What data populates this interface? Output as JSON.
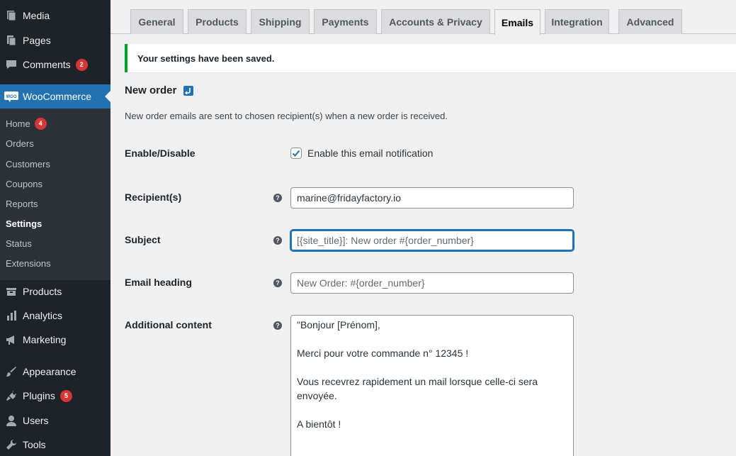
{
  "sidebar": {
    "items": [
      {
        "label": "Media",
        "icon": "media-icon"
      },
      {
        "label": "Pages",
        "icon": "pages-icon"
      },
      {
        "label": "Comments",
        "icon": "comments-icon",
        "badge": "2"
      },
      {
        "label": "WooCommerce",
        "icon": "woocommerce-icon"
      },
      {
        "label": "Products",
        "icon": "products-icon"
      },
      {
        "label": "Analytics",
        "icon": "analytics-icon"
      },
      {
        "label": "Marketing",
        "icon": "marketing-icon"
      },
      {
        "label": "Appearance",
        "icon": "appearance-icon"
      },
      {
        "label": "Plugins",
        "icon": "plugins-icon",
        "badge": "5"
      },
      {
        "label": "Users",
        "icon": "users-icon"
      },
      {
        "label": "Tools",
        "icon": "tools-icon"
      }
    ],
    "woo_icon_text": "WOO",
    "submenu": [
      {
        "label": "Home",
        "badge": "4"
      },
      {
        "label": "Orders"
      },
      {
        "label": "Customers"
      },
      {
        "label": "Coupons"
      },
      {
        "label": "Reports"
      },
      {
        "label": "Settings"
      },
      {
        "label": "Status"
      },
      {
        "label": "Extensions"
      }
    ]
  },
  "tabs": [
    "General",
    "Products",
    "Shipping",
    "Payments",
    "Accounts & Privacy",
    "Emails",
    "Integration",
    "Advanced"
  ],
  "active_tab": "Emails",
  "notice": "Your settings have been saved.",
  "page": {
    "title": "New order",
    "description": "New order emails are sent to chosen recipient(s) when a new order is received."
  },
  "form": {
    "enable_label": "Enable/Disable",
    "enable_checkbox_label": "Enable this email notification",
    "enable_checked": true,
    "recipient_label": "Recipient(s)",
    "recipient_value": "marine@fridayfactory.io",
    "subject_label": "Subject",
    "subject_placeholder": "[{site_title}]: New order #{order_number}",
    "heading_label": "Email heading",
    "heading_placeholder": "New Order: #{order_number}",
    "additional_label": "Additional content",
    "additional_value": "\"Bonjour [Prénom],\n\nMerci pour votre commande n° 12345 !\n\nVous recevrez rapidement un mail lorsque celle-ci sera envoyée.\n\nA bientôt !",
    "help_glyph": "?"
  },
  "colors": {
    "sidebar_bg": "#1d2327",
    "accent": "#2271b1",
    "badge": "#d63638",
    "success": "#00a32a"
  }
}
